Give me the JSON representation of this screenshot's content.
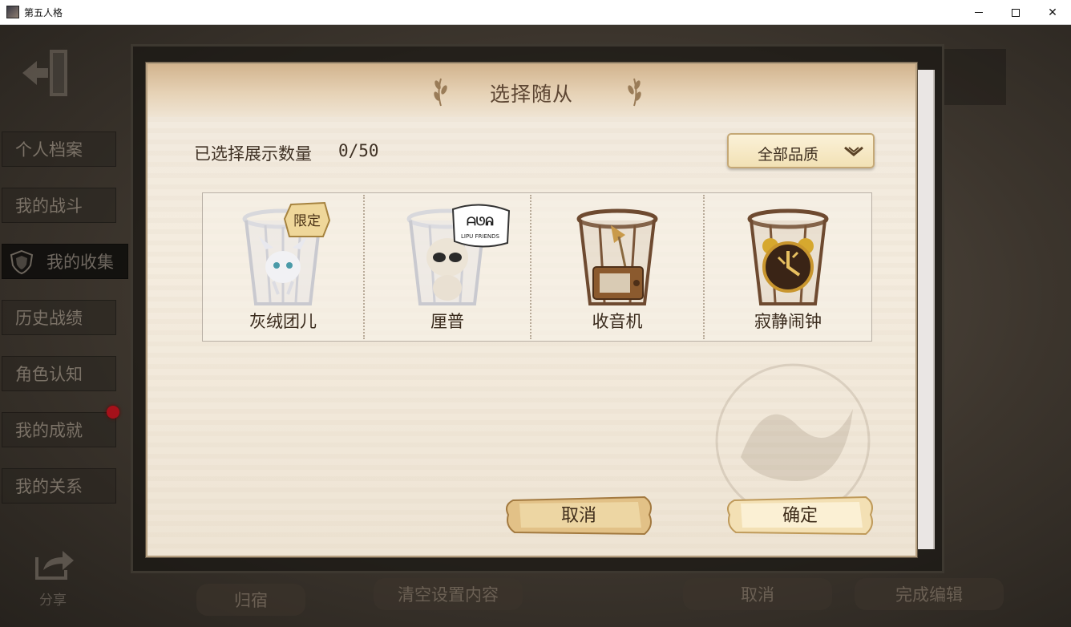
{
  "window": {
    "title": "第五人格",
    "minimize_glyph": "—",
    "maximize_glyph": "☐",
    "close_glyph": "✕"
  },
  "sidebar": {
    "items": [
      {
        "label": "个人档案",
        "active": false
      },
      {
        "label": "我的战斗",
        "active": false
      },
      {
        "label": "我的收集",
        "active": true
      },
      {
        "label": "历史战绩",
        "active": false
      },
      {
        "label": "角色认知",
        "active": false
      },
      {
        "label": "我的成就",
        "active": false,
        "notification": true
      },
      {
        "label": "我的关系",
        "active": false
      }
    ],
    "share_label": "分享"
  },
  "bottom_bar": {
    "dorm_label": "归宿",
    "clear_label": "清空设置内容",
    "cancel_label": "取消",
    "finish_label": "完成编辑"
  },
  "dialog": {
    "title": "选择随从",
    "count_label": "已选择展示数量",
    "count_value": "0/50",
    "quality_filter": "全部品质",
    "items": [
      {
        "name": "灰绒团儿",
        "icon": "caged-white-fluffy-creature-icon",
        "badge": "限定"
      },
      {
        "name": "厘普",
        "icon": "caged-lipu-creature-icon",
        "badge": "LIPU FRIENDS"
      },
      {
        "name": "收音机",
        "icon": "caged-radio-icon",
        "badge": ""
      },
      {
        "name": "寂静闹钟",
        "icon": "caged-alarm-clock-icon",
        "badge": ""
      }
    ],
    "cancel_label": "取消",
    "confirm_label": "确定"
  },
  "colors": {
    "dialog_paper": "#f2eadd",
    "header_gradient_top": "#d2b48e",
    "button_gold": "#f0d9a8",
    "notification_red": "#a5111a"
  }
}
